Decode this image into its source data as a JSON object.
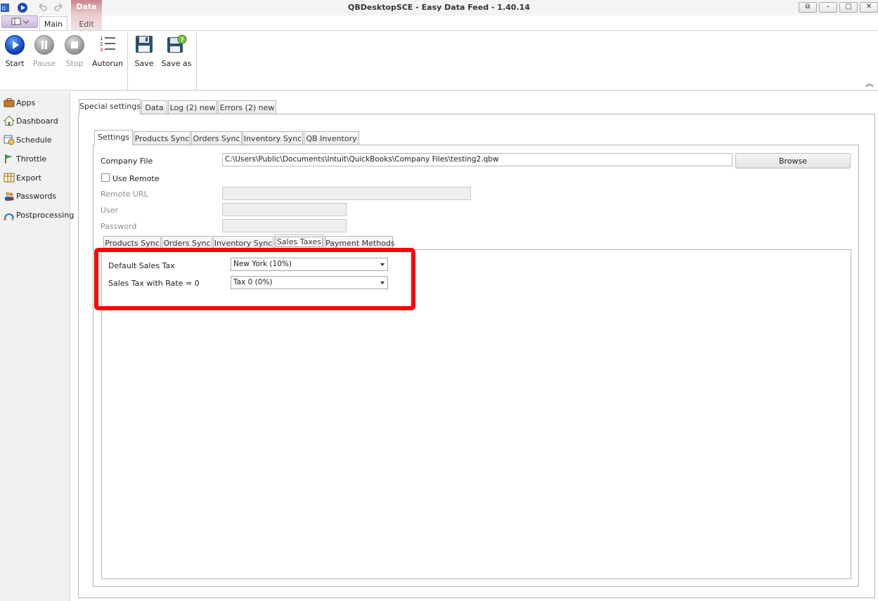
{
  "window": {
    "title": "QBDesktopSCE - Easy Data Feed - 1.40.14",
    "controls": [
      "⧉",
      "–",
      "▢",
      "✕"
    ]
  },
  "ribbon": {
    "context_group": "Data",
    "tabs": {
      "main": "Main",
      "edit": "Edit"
    },
    "buttons": {
      "start": "Start",
      "pause": "Pause",
      "stop": "Stop",
      "autorun": "Autorun",
      "save": "Save",
      "save_as": "Save as"
    },
    "collapse_glyph": "︽"
  },
  "sidebar": {
    "items": [
      {
        "label": "Apps",
        "icon": "briefcase-icon"
      },
      {
        "label": "Dashboard",
        "icon": "home-icon"
      },
      {
        "label": "Schedule",
        "icon": "schedule-icon"
      },
      {
        "label": "Throttle",
        "icon": "flag-icon"
      },
      {
        "label": "Export",
        "icon": "table-icon"
      },
      {
        "label": "Passwords",
        "icon": "users-icon"
      },
      {
        "label": "Postprocessing",
        "icon": "postprocessing-icon"
      }
    ]
  },
  "main_tabs": [
    "Special settings",
    "Data",
    "Log (2) new",
    "Errors (2) new"
  ],
  "settings_tabs": [
    "Settings",
    "Products Sync",
    "Orders Sync",
    "Inventory Sync",
    "QB Inventory"
  ],
  "settings": {
    "company_file_label": "Company File",
    "company_file_value": "C:\\Users\\Public\\Documents\\Intuit\\QuickBooks\\Company Files\\testing2.qbw",
    "browse_label": "Browse",
    "use_remote_label": "Use Remote",
    "remote_url_label": "Remote URL",
    "user_label": "User",
    "password_label": "Password"
  },
  "inner_tabs": [
    "Products Sync",
    "Orders Sync",
    "Inventory Sync",
    "Sales Taxes",
    "Payment Methods"
  ],
  "sales_taxes": {
    "default_label": "Default Sales Tax",
    "default_value": "New York (10%)",
    "zero_rate_label": "Sales Tax with Rate = 0",
    "zero_rate_value": "Tax 0 (0%)"
  },
  "colors": {
    "highlight": "#ff0000",
    "context_group": "#c9858a",
    "start_button": "#0a3fb3"
  }
}
